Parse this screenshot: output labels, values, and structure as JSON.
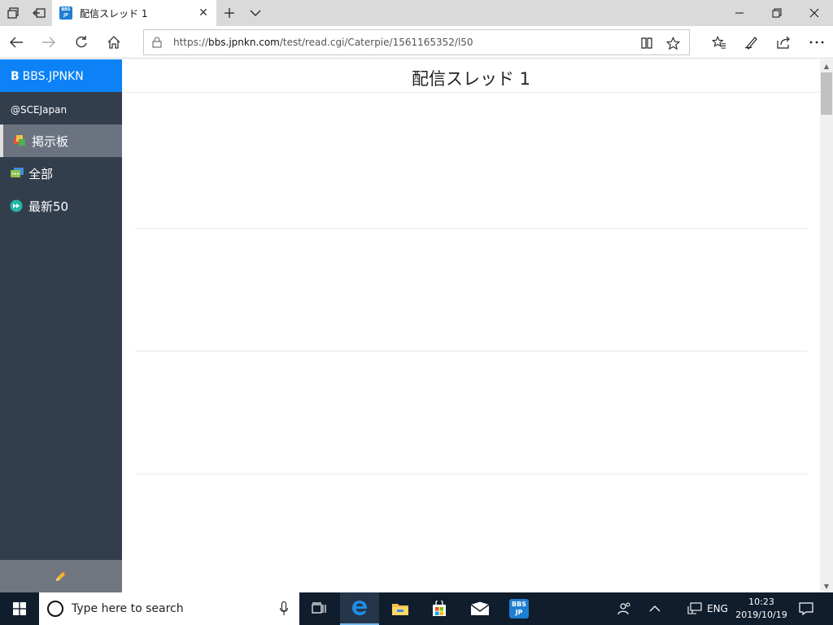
{
  "browser": {
    "tab_title": "配信スレッド 1",
    "tab_favicon_text": "BBS JP",
    "url_prefix": "https://",
    "url_host": "bbs.jpnkn.com",
    "url_path": "/test/read.cgi/Caterpie/1561165352/l50"
  },
  "sidebar": {
    "brand_mark": "B",
    "brand_name": "BBS.JPNKN",
    "user_handle": "@SCEJapan",
    "items": [
      {
        "label": "掲示板",
        "icon": "boards-icon",
        "active": true
      },
      {
        "label": "全部",
        "icon": "chat-icon",
        "active": false
      },
      {
        "label": "最新50",
        "icon": "fast-forward-icon",
        "active": false
      }
    ],
    "compose_icon": "pencil-icon"
  },
  "content": {
    "title": "配信スレッド 1"
  },
  "taskbar": {
    "search_placeholder": "Type here to search",
    "lang": "ENG",
    "time": "10:23",
    "date": "2019/10/19",
    "app_badge": "BBS JP"
  },
  "colors": {
    "brand_blue": "#0d82f6",
    "sidebar_bg": "#333e4d",
    "taskbar_bg": "#101d2d"
  }
}
